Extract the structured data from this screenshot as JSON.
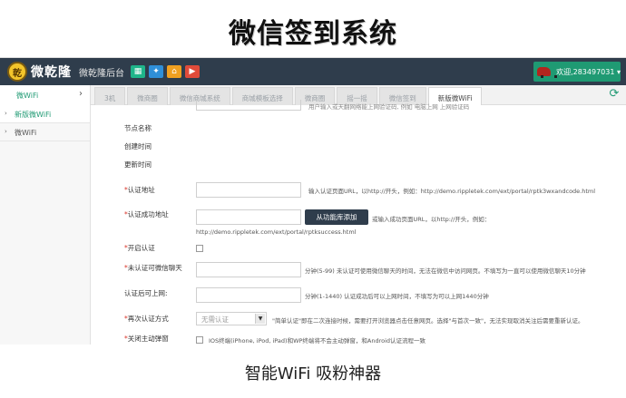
{
  "promo": {
    "title": "微信签到系统",
    "caption": "智能WiFi 吸粉神器"
  },
  "header": {
    "logo_badge": "乾",
    "brand": "微乾隆",
    "subtitle": "微乾隆后台",
    "toolbar_icons": [
      {
        "name": "grid-icon",
        "glyph": "▦",
        "color": "#1fb58a"
      },
      {
        "name": "gear-icon",
        "glyph": "✦",
        "color": "#2f8fd8"
      },
      {
        "name": "home-icon",
        "glyph": "⌂",
        "color": "#f0a020"
      },
      {
        "name": "play-icon",
        "glyph": "▶",
        "color": "#e04b3a"
      }
    ],
    "user_label": "欢迎,283497031 ▾"
  },
  "breadcrumb": {
    "label": "微WiFi",
    "arrow": "›"
  },
  "tabs": [
    {
      "label": "3机",
      "active": false
    },
    {
      "label": "微商圈",
      "active": false
    },
    {
      "label": "微信商城系统",
      "active": false
    },
    {
      "label": "商城模板选择",
      "active": false
    },
    {
      "label": "微商圈",
      "active": false
    },
    {
      "label": "摇一摇",
      "active": false
    },
    {
      "label": "微信签到",
      "active": false
    },
    {
      "label": "新版微WiFi",
      "active": true
    }
  ],
  "refresh_glyph": "⟳",
  "sidebar": {
    "items": [
      {
        "label": "新版微WiFi",
        "active": true,
        "chevron": "›"
      },
      {
        "label": "微WiFi",
        "active": false,
        "chevron": "›"
      }
    ]
  },
  "form": {
    "top_hint": "用户输入或天翻网络能上网验证码, 例如 电脑上网 上网验证码",
    "plain_labels": [
      "节点名称",
      "创建时间",
      "更新时间"
    ],
    "auth_url": {
      "label": "认证地址",
      "value": "",
      "hint": "输入认证页面URL，以http://开头，例如：http://demo.rippletek.com/ext/portal/rptk3wxandcode.html"
    },
    "auth_success_url": {
      "label": "认证成功地址",
      "value": "",
      "button": "从功能库添加",
      "hint1": "或输入成功页面URL，以http://开头，例如：",
      "hint2": "http://demo.rippletek.com/ext/portal/rptksuccess.html"
    },
    "enable_auth": {
      "label": "开启认证",
      "checked": false
    },
    "unauth_minutes": {
      "label": "未认证可微信聊天",
      "value": "",
      "hint": "分钟(5-99)  未认证可使用微信聊天的时间，无法在微信中访问网页。不填写为一直可以使用微信聊天10分钟"
    },
    "after_auth": {
      "label": "认证后可上网:",
      "value": "",
      "hint": "分钟(1-1440)  认证成功后可以上网时间，不填写为可以上网1440分钟"
    },
    "reauth": {
      "label": "再次认证方式",
      "selected": "无需认证",
      "hint": "\"简单认证\"即在二次连接时候，需要打开浏览器点击任意网页。选择\"与首次一致\"，无法实现取消关注后需要重新认证。"
    },
    "close_popup": {
      "label": "关闭主动弹窗",
      "checked": false,
      "hint": "IOS终端(iPhone, iPod, iPad)和WP终端将不会主动弹窗，和Android认证流程一致"
    }
  }
}
